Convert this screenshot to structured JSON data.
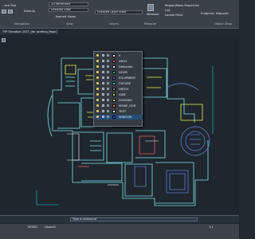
{
  "ribbon": {
    "left": {
      "top_left": "...ack Plot",
      "extents_label": "Extents",
      "bottom_label": "Navigation"
    },
    "viewport": {
      "field": "2D Wireframe",
      "views": "Unsaved View",
      "named_views": "Named Views",
      "label": "View"
    },
    "layers": {
      "label": "Layers",
      "current": "Unsaved Layer State"
    },
    "measure": {
      "label": "Measure",
      "tool": "Measure"
    },
    "properties": {
      "items": [
        "Region/Mass Properties",
        "List",
        "Locate Point"
      ]
    },
    "snap": {
      "label": "Endpoint, Midpoint",
      "osnap": "Object Snap"
    }
  },
  "document": {
    "tab": "TYP Elevation 2017_(for drafting_Page 1"
  },
  "layer_panel": {
    "rows": [
      {
        "name": "0",
        "color": "#ffffff",
        "selected": false
      },
      {
        "name": "ARCH",
        "color": "#ff5f5f",
        "selected": false
      },
      {
        "name": "Defpoints",
        "color": "#ffffff",
        "selected": false
      },
      {
        "name": "DOOR",
        "color": "#17c16b",
        "selected": false
      },
      {
        "name": "EQUIPMENT",
        "color": "#5f4fe6",
        "selected": false
      },
      {
        "name": "FIXTURE",
        "color": "#00d3da",
        "selected": false
      },
      {
        "name": "HATCH",
        "color": "#7a8791",
        "selected": false
      },
      {
        "name": "HIDE",
        "color": "#d3cf21",
        "selected": false
      },
      {
        "name": "HOUSING",
        "color": "#ffd04f",
        "selected": false
      },
      {
        "name": "SPARE_DOR",
        "color": "#ff7a24",
        "selected": false
      },
      {
        "name": "TEXT",
        "color": "#ffffff",
        "selected": false
      },
      {
        "name": "WINDOW",
        "color": "#2f54ff",
        "selected": true
      }
    ]
  },
  "command": {
    "prompt": "Type a command"
  },
  "status": {
    "model": "MODEL",
    "tab": "Layout1",
    "zoom": "1:1"
  }
}
